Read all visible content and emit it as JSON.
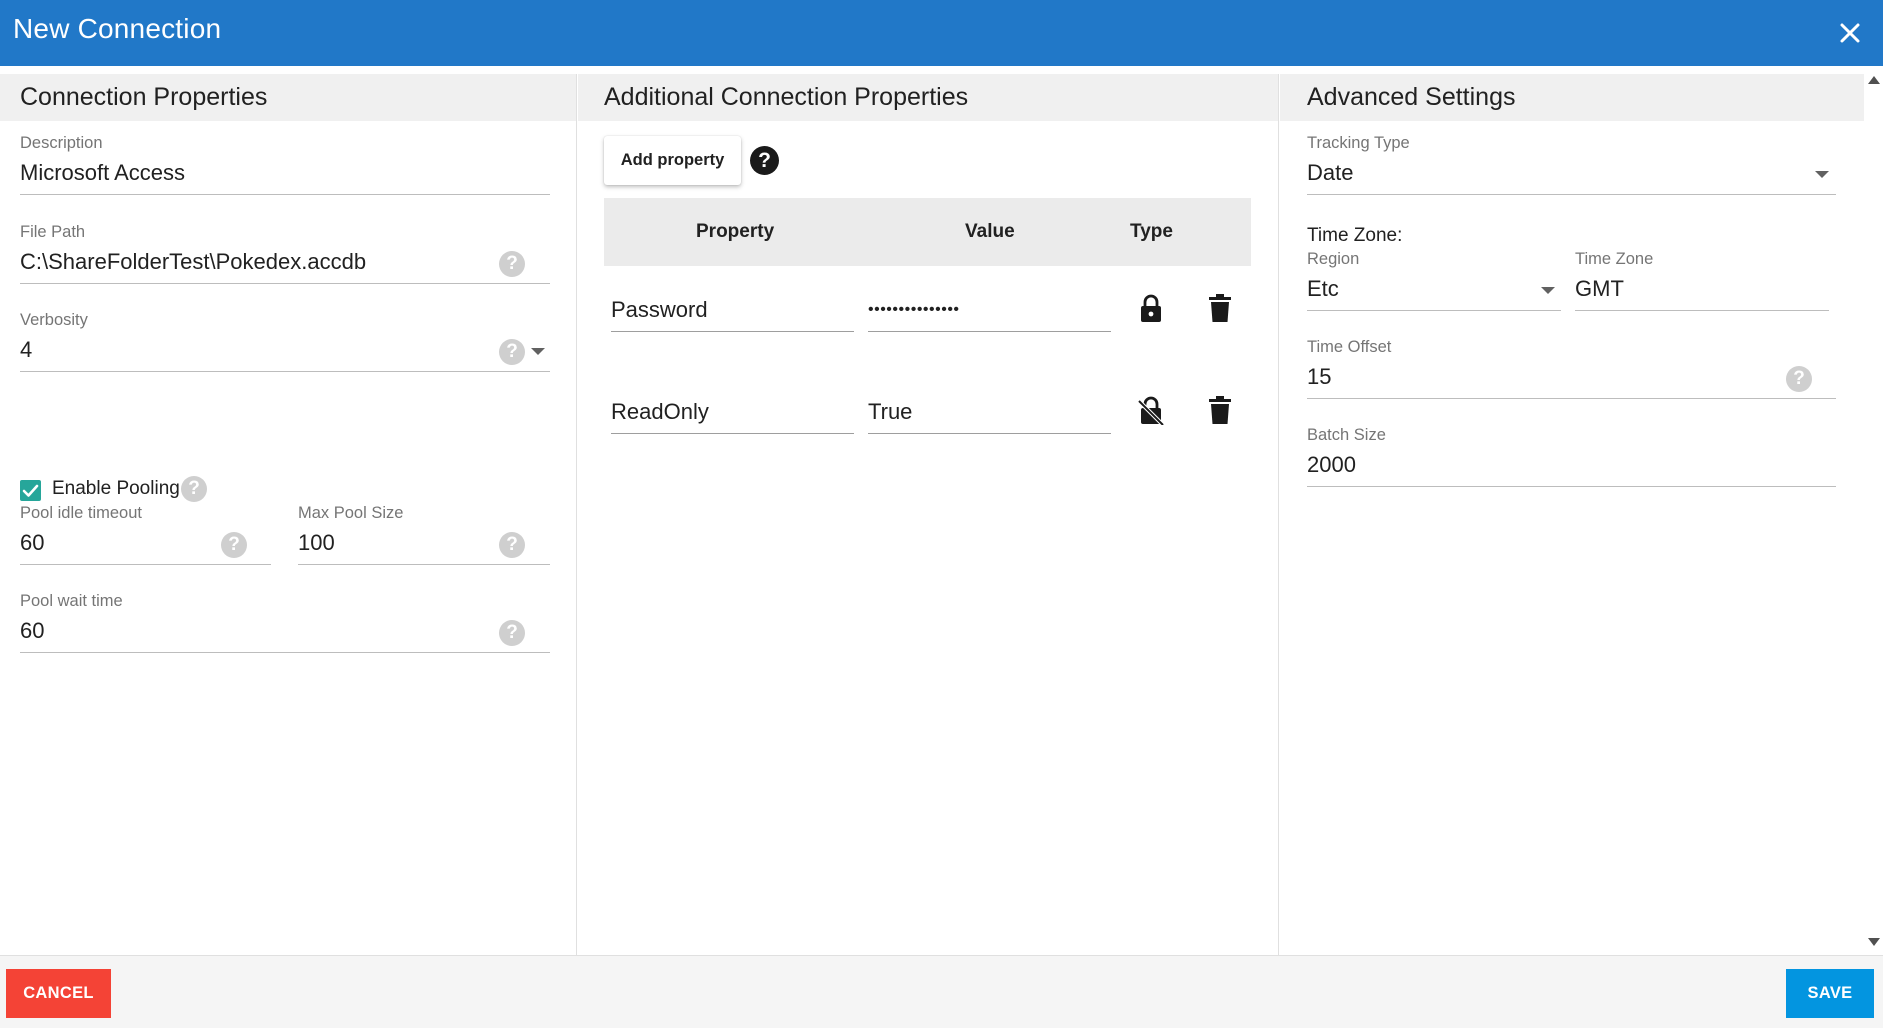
{
  "window": {
    "title": "New Connection",
    "close_icon": "close-icon",
    "header_color": "#2178c8"
  },
  "connection_properties": {
    "header": "Connection Properties",
    "description": {
      "label": "Description",
      "value": "Microsoft Access"
    },
    "file_path": {
      "label": "File Path",
      "value": "C:\\ShareFolderTest\\Pokedex.accdb"
    },
    "verbosity": {
      "label": "Verbosity",
      "value": "4"
    },
    "enable_pooling": {
      "label": "Enable Pooling",
      "checked": true
    },
    "pool_idle_timeout": {
      "label": "Pool idle timeout",
      "value": "60"
    },
    "max_pool_size": {
      "label": "Max Pool Size",
      "value": "100"
    },
    "pool_wait_time": {
      "label": "Pool wait time",
      "value": "60"
    },
    "help_glyph": "?"
  },
  "additional_properties": {
    "header": "Additional Connection Properties",
    "add_button": "Add property",
    "help_glyph": "?",
    "columns": {
      "property": "Property",
      "value": "Value",
      "type": "Type"
    },
    "rows": [
      {
        "property": "Password",
        "value": "•••••••••••••••",
        "type_icon": "lock-icon",
        "delete_icon": "trash-icon"
      },
      {
        "property": "ReadOnly",
        "value": "True",
        "type_icon": "unlocked-icon",
        "delete_icon": "trash-icon"
      }
    ]
  },
  "advanced_settings": {
    "header": "Advanced Settings",
    "tracking_type": {
      "label": "Tracking Type",
      "value": "Date"
    },
    "time_zone_heading": "Time Zone:",
    "region": {
      "label": "Region",
      "value": "Etc"
    },
    "time_zone": {
      "label": "Time Zone",
      "value": "GMT"
    },
    "time_offset": {
      "label": "Time Offset",
      "value": "15"
    },
    "batch_size": {
      "label": "Batch Size",
      "value": "2000"
    }
  },
  "footer": {
    "cancel_label": "CANCEL",
    "save_label": "SAVE",
    "cancel_color": "#f44336",
    "save_color": "#0395e0"
  }
}
